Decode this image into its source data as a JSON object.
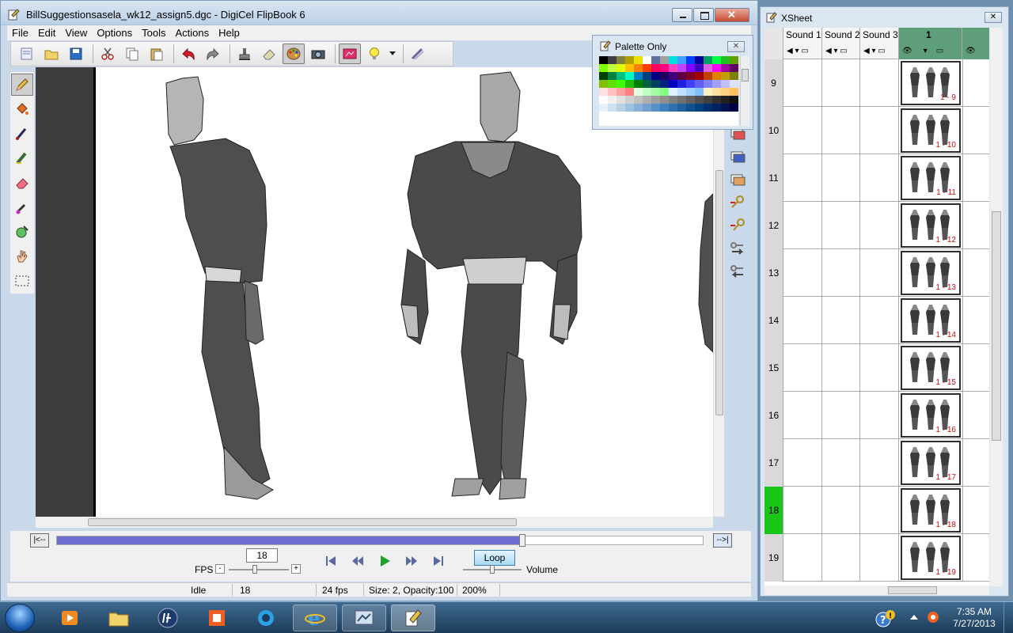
{
  "window": {
    "title": "BillSuggestionsasela_wk12_assign5.dgc - DigiCel FlipBook 6"
  },
  "menu": [
    "File",
    "Edit",
    "View",
    "Options",
    "Tools",
    "Actions",
    "Help"
  ],
  "toolbar_icons": [
    "new-doc-icon",
    "open-folder-icon",
    "save-icon",
    "cut-icon",
    "copy-icon",
    "paste-icon",
    "undo-icon",
    "redo-icon",
    "stamp-icon",
    "eraser-icon",
    "palette-icon",
    "camera-icon",
    "card-icon",
    "lightbulb-icon",
    "brush-settings-icon"
  ],
  "timeline": {
    "left_btn": "|<--",
    "right_btn": "-->|",
    "progress": 0.72,
    "fps_value": "18",
    "fps_label": "FPS",
    "minus": "-",
    "plus": "+",
    "loop_label": "Loop",
    "volume_label": "Volume"
  },
  "status": {
    "state": "Idle",
    "frame": "18",
    "fps": "24 fps",
    "size": "Size:  2, Opacity:100",
    "zoom": "200%"
  },
  "palette": {
    "title": "Palette Only",
    "close": "✕",
    "swatches": [
      "#000000",
      "#404040",
      "#808040",
      "#b0a000",
      "#e8e000",
      "#ffffff",
      "#6070a0",
      "#a0a0a0",
      "#00e0e0",
      "#40a0ff",
      "#0040ff",
      "#0000a0",
      "#00a060",
      "#00ff40",
      "#20c020",
      "#60a000",
      "#80ff00",
      "#c0ff40",
      "#e0ff00",
      "#ffc000",
      "#ff8000",
      "#ff4000",
      "#ff0060",
      "#ff0080",
      "#ff40c0",
      "#c040ff",
      "#8000ff",
      "#4000c0",
      "#e060e0",
      "#ff00ff",
      "#a000a0",
      "#600060",
      "#004000",
      "#008040",
      "#00c080",
      "#00ffc0",
      "#0080c0",
      "#004080",
      "#000080",
      "#200060",
      "#400080",
      "#600040",
      "#800020",
      "#a00000",
      "#c04000",
      "#e08000",
      "#c0a000",
      "#808000",
      "#80c000",
      "#60e000",
      "#40ff00",
      "#20c000",
      "#008000",
      "#006040",
      "#004060",
      "#002080",
      "#0000c0",
      "#2020e0",
      "#4040ff",
      "#6060ff",
      "#8080ff",
      "#a0a0ff",
      "#c0c0ff",
      "#e0e0ff",
      "#ffe0e0",
      "#ffc0c0",
      "#ffa0a0",
      "#ff8080",
      "#e0ffe0",
      "#c0ffc0",
      "#a0ffa0",
      "#80ff80",
      "#e0f0ff",
      "#c0e0ff",
      "#a0d0ff",
      "#80c0ff",
      "#fff0c0",
      "#ffe0a0",
      "#ffd080",
      "#ffc060",
      "#ffffff",
      "#f0f0f0",
      "#e0e0e0",
      "#d0d0d0",
      "#c0c0c0",
      "#b0b0b0",
      "#a0a0a0",
      "#909090",
      "#808080",
      "#707070",
      "#606060",
      "#505050",
      "#404040",
      "#303030",
      "#202020",
      "#101010",
      "#e8f0f8",
      "#d0e0f0",
      "#b8d0e8",
      "#a0c0e0",
      "#88b0d8",
      "#70a0d0",
      "#5890c8",
      "#4080c0",
      "#3070b0",
      "#2060a0",
      "#105090",
      "#004080",
      "#003070",
      "#002060",
      "#001050",
      "#000040"
    ]
  },
  "xsheet": {
    "title": "XSheet",
    "close": "✕",
    "columns": [
      "Sound 1",
      "Sound 2",
      "Sound 3"
    ],
    "layer_label": "1",
    "current_frame": 18,
    "rows": [
      {
        "num": "9",
        "label": "1 - 9"
      },
      {
        "num": "10",
        "label": "1 - 10"
      },
      {
        "num": "11",
        "label": "1 - 11"
      },
      {
        "num": "12",
        "label": "1 - 12"
      },
      {
        "num": "13",
        "label": "1 - 13"
      },
      {
        "num": "14",
        "label": "1 - 14"
      },
      {
        "num": "15",
        "label": "1 - 15"
      },
      {
        "num": "16",
        "label": "1 - 16"
      },
      {
        "num": "17",
        "label": "1 - 17"
      },
      {
        "num": "18",
        "label": "1 - 18"
      },
      {
        "num": "19",
        "label": "1 - 19"
      }
    ]
  },
  "taskbar": {
    "time": "7:35 AM",
    "date": "7/27/2013"
  },
  "colors": {
    "timeline_fill": "#6d6ed0",
    "current_frame": "#18c518",
    "layer_header": "#5f9e7a",
    "frame_label": "#d01010"
  }
}
